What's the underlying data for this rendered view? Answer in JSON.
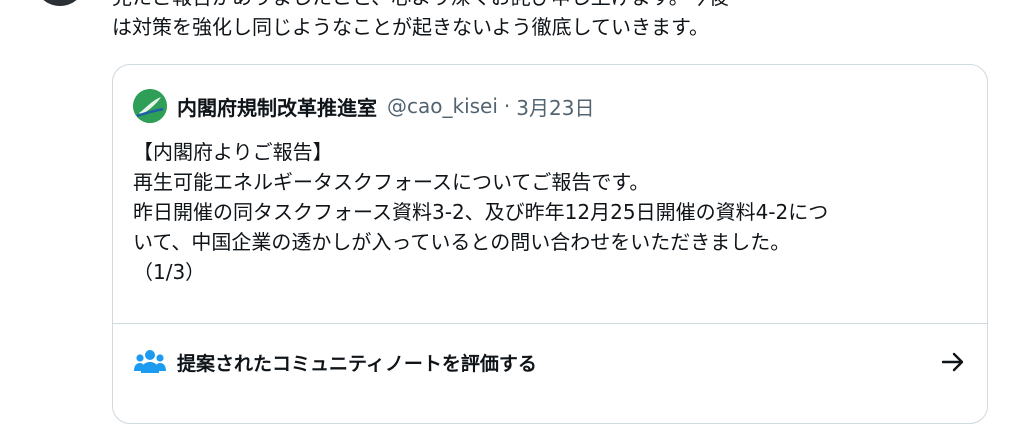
{
  "tweet": {
    "text": "見たご報告がありましたこと、心より深くお詫び申し上げます。今後\nは対策を強化し同じようなことが起きないよう徹底していきます。"
  },
  "quote": {
    "author_name": "内閣府規制改革推進室",
    "author_handle": "@cao_kisei",
    "separator": "·",
    "date": "3月23日",
    "lines": [
      "【内閣府よりご報告】",
      "再生可能エネルギータスクフォースについてご報告です。",
      "昨日開催の同タスクフォース資料3-2、及び昨年12月25日開催の資料4-2につ",
      "いて、中国企業の透かしが入っているとの問い合わせをいただきました。",
      "（1/3）"
    ]
  },
  "community_note": {
    "label": "提案されたコミュニティノートを評価する",
    "icon": "people-icon",
    "arrow_icon": "arrow-right-icon"
  },
  "colors": {
    "text": "#0f1419",
    "secondary": "#536471",
    "border": "#cfd9de",
    "accent": "#1d9bf0",
    "avatar": "#2f9e56"
  }
}
